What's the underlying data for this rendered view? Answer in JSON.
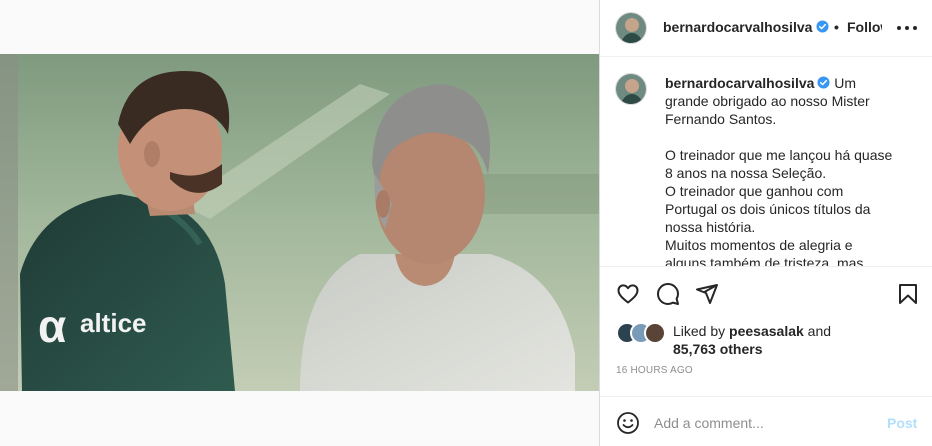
{
  "post": {
    "username": "bernardocarvalhosilva",
    "follow_label": "Follow",
    "dot": "•",
    "caption": {
      "username": "bernardocarvalhosilva",
      "line1": "Um",
      "lines": [
        "grande obrigado ao nosso Mister",
        "Fernando Santos.",
        "",
        "O treinador que me lançou há quase",
        "8 anos na nossa Seleção.",
        "O treinador que ganhou com",
        "Portugal os dois únicos títulos da",
        "nossa história.",
        "Muitos momentos de alegria e",
        "alguns também de tristeza, mas"
      ]
    },
    "photo": {
      "shirt_logo_text": "altice"
    },
    "likes": {
      "prefix": "Liked by",
      "user": "peesasalak",
      "and": "and",
      "others": "85,763 others"
    },
    "timestamp": "16 HOURS AGO",
    "comment": {
      "placeholder": "Add a comment...",
      "post_label": "Post"
    }
  },
  "icons": {
    "verified": "verified-badge-icon",
    "more": "more-options-icon",
    "like": "heart-icon",
    "comment": "comment-icon",
    "share": "share-icon",
    "save": "bookmark-icon",
    "emoji": "emoji-icon"
  },
  "colors": {
    "verified_blue": "#3897f0",
    "post_button_disabled": "#b2dffc",
    "muted_text": "#8e8e8e",
    "text": "#262626"
  }
}
